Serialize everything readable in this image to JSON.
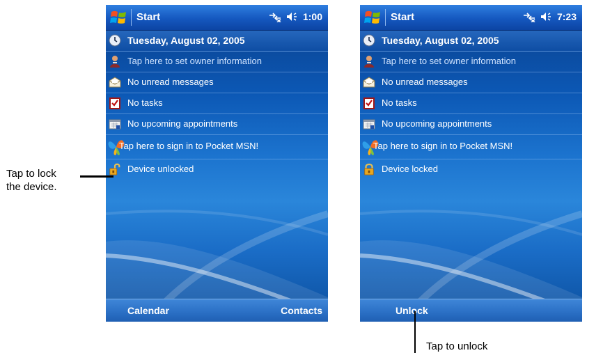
{
  "left_screen": {
    "start_label": "Start",
    "clock": "1:00",
    "date": "Tuesday, August 02, 2005",
    "owner": "Tap here to set owner information",
    "messages": "No unread messages",
    "tasks": "No tasks",
    "appointments": "No upcoming appointments",
    "msn": "Tap here to sign in to Pocket MSN!",
    "device_status": "Device unlocked",
    "softkey_left": "Calendar",
    "softkey_right": "Contacts"
  },
  "right_screen": {
    "start_label": "Start",
    "clock": "7:23",
    "date": "Tuesday, August 02, 2005",
    "owner": "Tap here to set owner information",
    "messages": "No unread messages",
    "tasks": "No tasks",
    "appointments": "No upcoming appointments",
    "msn": "Tap here to sign in to Pocket MSN!",
    "device_status": "Device locked",
    "softkey_left": "Unlock"
  },
  "annotations": {
    "lock_line1": "Tap to lock",
    "lock_line2": "the device.",
    "unlock": "Tap to unlock"
  },
  "icons": [
    "windows-flag-icon",
    "connectivity-icon",
    "speaker-icon",
    "clock-icon",
    "owner-icon",
    "envelope-icon",
    "tasks-icon",
    "calendar-icon",
    "msn-butterfly-icon",
    "padlock-open-icon",
    "padlock-closed-icon"
  ],
  "colors": {
    "title_bar": "#1558bf",
    "background": "#0c58b5",
    "text": "#ffffff"
  }
}
